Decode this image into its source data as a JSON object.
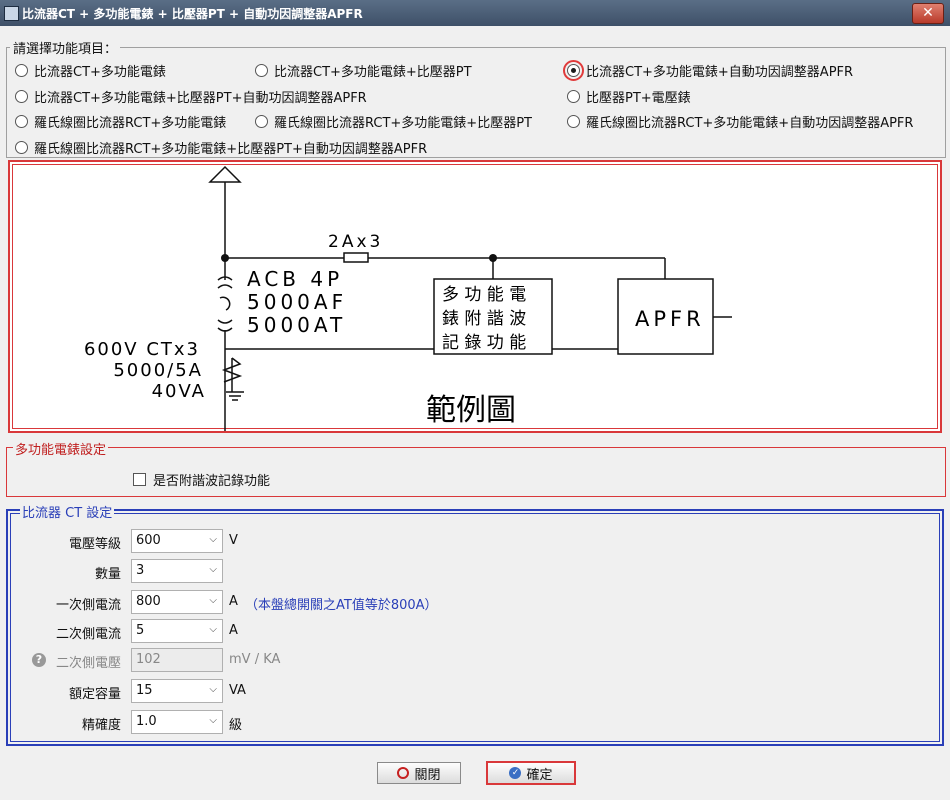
{
  "window": {
    "title": "比流器CT + 多功能電錶 + 比壓器PT + 自動功因調整器APFR",
    "close": "✕"
  },
  "function_group": {
    "legend": "請選擇功能項目：",
    "options": [
      {
        "label": "比流器CT+多功能電錶",
        "checked": false
      },
      {
        "label": "比流器CT+多功能電錶+比壓器PT",
        "checked": false
      },
      {
        "label": "比流器CT+多功能電錶+自動功因調整器APFR",
        "checked": true
      },
      {
        "label": "比流器CT+多功能電錶+比壓器PT+自動功因調整器APFR",
        "checked": false
      },
      {
        "label": "比壓器PT+電壓錶",
        "checked": false
      },
      {
        "label": "羅氏線圈比流器RCT+多功能電錶",
        "checked": false
      },
      {
        "label": "羅氏線圈比流器RCT+多功能電錶+比壓器PT",
        "checked": false
      },
      {
        "label": "羅氏線圈比流器RCT+多功能電錶+自動功因調整器APFR",
        "checked": false
      },
      {
        "label": "羅氏線圈比流器RCT+多功能電錶+比壓器PT+自動功因調整器APFR",
        "checked": false
      }
    ]
  },
  "diagram": {
    "fuse_label": "2Ax3",
    "acb_lines": [
      "ACB 4P",
      "5000AF",
      "5000AT"
    ],
    "ct_lines": [
      "600V CTx3",
      "5000/5A",
      "40VA"
    ],
    "meter_lines": [
      "多 功 能 電",
      "錶 附 諧 波",
      "記 錄 功 能"
    ],
    "apfr_label": "APFR",
    "caption": "範例圖"
  },
  "meter_settings": {
    "legend": "多功能電錶設定",
    "harmonic_label": "是否附諧波記錄功能",
    "harmonic_checked": false
  },
  "ct_settings": {
    "legend": "比流器 CT 設定",
    "rows": [
      {
        "label": "電壓等級",
        "value": "600",
        "unit": "V"
      },
      {
        "label": "數量",
        "value": "3",
        "unit": ""
      },
      {
        "label": "一次側電流",
        "value": "800",
        "unit": "A",
        "note": "（本盤總開關之AT值等於800A）"
      },
      {
        "label": "二次側電流",
        "value": "5",
        "unit": "A"
      },
      {
        "label": "二次側電壓",
        "value": "102",
        "unit": "mV / KA"
      },
      {
        "label": "額定容量",
        "value": "15",
        "unit": "VA"
      },
      {
        "label": "精確度",
        "value": "1.0",
        "unit": "級"
      }
    ]
  },
  "buttons": {
    "close_label": "關閉",
    "confirm_label": "確定"
  }
}
